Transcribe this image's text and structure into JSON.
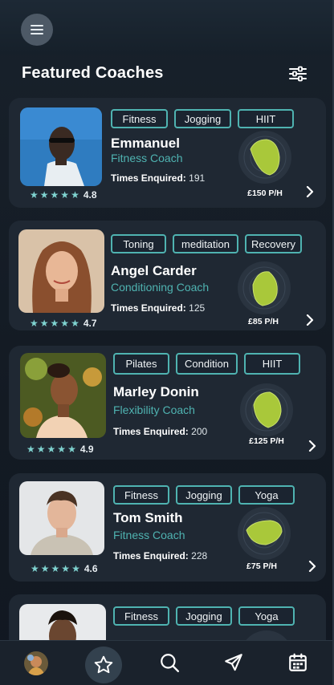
{
  "header": {
    "title": "Featured Coaches"
  },
  "coaches": [
    {
      "tags": [
        "Fitness",
        "Jogging",
        "HIIT"
      ],
      "name": "Emmanuel",
      "role": "Fitness Coach",
      "enquired_label": "Times Enquired:",
      "enquired": "191",
      "rating": "4.8",
      "price": "£150 P/H"
    },
    {
      "tags": [
        "Toning",
        "meditation",
        "Recovery"
      ],
      "name": "Angel Carder",
      "role": "Conditioning Coach",
      "enquired_label": "Times Enquired:",
      "enquired": "125",
      "rating": "4.7",
      "price": "£85 P/H"
    },
    {
      "tags": [
        "Pilates",
        "Condition",
        "HIIT"
      ],
      "name": "Marley Donin",
      "role": "Flexibility Coach",
      "enquired_label": "Times Enquired:",
      "enquired": "200",
      "rating": "4.9",
      "price": "£125 P/H"
    },
    {
      "tags": [
        "Fitness",
        "Jogging",
        "Yoga"
      ],
      "name": "Tom Smith",
      "role": "Fitness Coach",
      "enquired_label": "Times Enquired:",
      "enquired": "228",
      "rating": "4.6",
      "price": "£75 P/H"
    },
    {
      "tags": [
        "Fitness",
        "Jogging",
        "Yoga"
      ],
      "name": "",
      "role": "",
      "enquired_label": "",
      "enquired": "",
      "rating": "",
      "price": ""
    }
  ],
  "nav": {
    "items": [
      "profile-avatar",
      "star-icon",
      "search-icon",
      "send-icon",
      "calendar-icon"
    ],
    "active": "star-icon"
  },
  "colors": {
    "accent": "#4fb3b1",
    "radar_fill": "#a9c83a",
    "card": "#1f2833",
    "star": "#7fd3d0"
  }
}
